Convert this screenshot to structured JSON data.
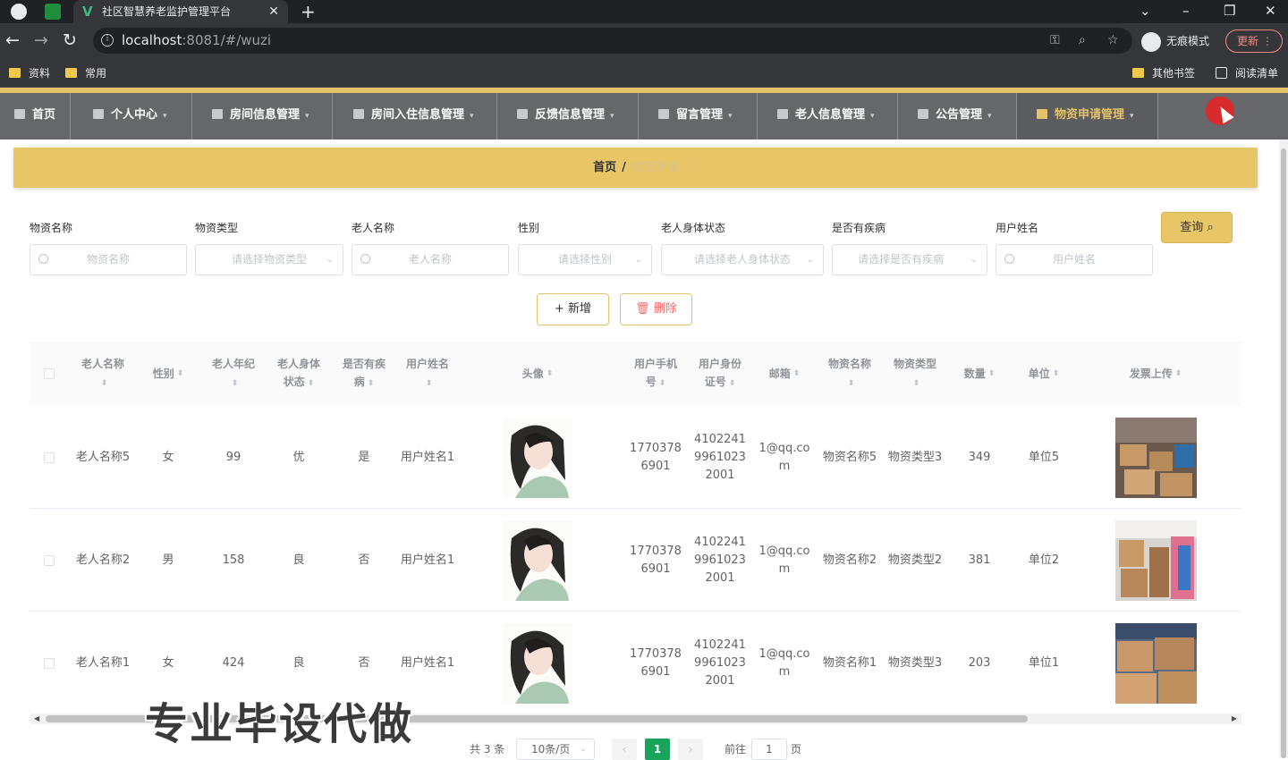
{
  "browser": {
    "tab_title": "社区智慧养老监护管理平台",
    "url_host": "localhost",
    "url_rest": ":8081/#/wuzi",
    "incognito_label": "无痕模式",
    "update_label": "更新",
    "bookmarks": [
      "资料",
      "常用"
    ],
    "other_bookmarks": "其他书签",
    "reading_list": "阅读清单"
  },
  "menu": [
    {
      "label": "首页"
    },
    {
      "label": "个人中心"
    },
    {
      "label": "房间信息管理"
    },
    {
      "label": "房间入住信息管理"
    },
    {
      "label": "反馈信息管理"
    },
    {
      "label": "留言管理"
    },
    {
      "label": "老人信息管理"
    },
    {
      "label": "公告管理"
    },
    {
      "label": "物资申请管理"
    }
  ],
  "breadcrumb": {
    "home": "首页",
    "sep": "/",
    "current": "物资申请"
  },
  "filters": {
    "labels": [
      "物资名称",
      "物资类型",
      "老人名称",
      "性别",
      "老人身体状态",
      "是否有疾病",
      "用户姓名"
    ],
    "placeholders": [
      "物资名称",
      "请选择物资类型",
      "老人名称",
      "请选择性别",
      "请选择老人身体状态",
      "请选择是否有疾病",
      "用户姓名"
    ],
    "query_button": "查询"
  },
  "actions": {
    "add": "新增",
    "delete": "删除"
  },
  "table": {
    "headers": [
      "老人名称",
      "性别",
      "老人年纪",
      "老人身体状态",
      "是否有疾病",
      "用户姓名",
      "头像",
      "用户手机号",
      "用户身份证号",
      "邮箱",
      "物资名称",
      "物资类型",
      "数量",
      "单位",
      "发票上传"
    ],
    "rows": [
      {
        "elder": "老人名称5",
        "gender": "女",
        "age": "99",
        "status": "优",
        "disease": "是",
        "user": "用户姓名1",
        "phone": "17703786901",
        "idcard": "410224199610232001",
        "email": "1@qq.com",
        "item": "物资名称5",
        "type": "物资类型3",
        "qty": "349",
        "unit": "单位5"
      },
      {
        "elder": "老人名称2",
        "gender": "男",
        "age": "158",
        "status": "良",
        "disease": "否",
        "user": "用户姓名1",
        "phone": "17703786901",
        "idcard": "410224199610232001",
        "email": "1@qq.com",
        "item": "物资名称2",
        "type": "物资类型2",
        "qty": "381",
        "unit": "单位2"
      },
      {
        "elder": "老人名称1",
        "gender": "女",
        "age": "424",
        "status": "良",
        "disease": "否",
        "user": "用户姓名1",
        "phone": "17703786901",
        "idcard": "410224199610232001",
        "email": "1@qq.com",
        "item": "物资名称1",
        "type": "物资类型3",
        "qty": "203",
        "unit": "单位1"
      }
    ]
  },
  "pagination": {
    "total": "共 3 条",
    "page_size": "10条/页",
    "current": "1",
    "goto": "前往",
    "goto_value": "1",
    "page_unit": "页"
  },
  "watermark": "专业毕设代做",
  "colors": {
    "accent": "#e8c567",
    "menu_bg": "#65676b",
    "active_page": "#1aa35a"
  }
}
